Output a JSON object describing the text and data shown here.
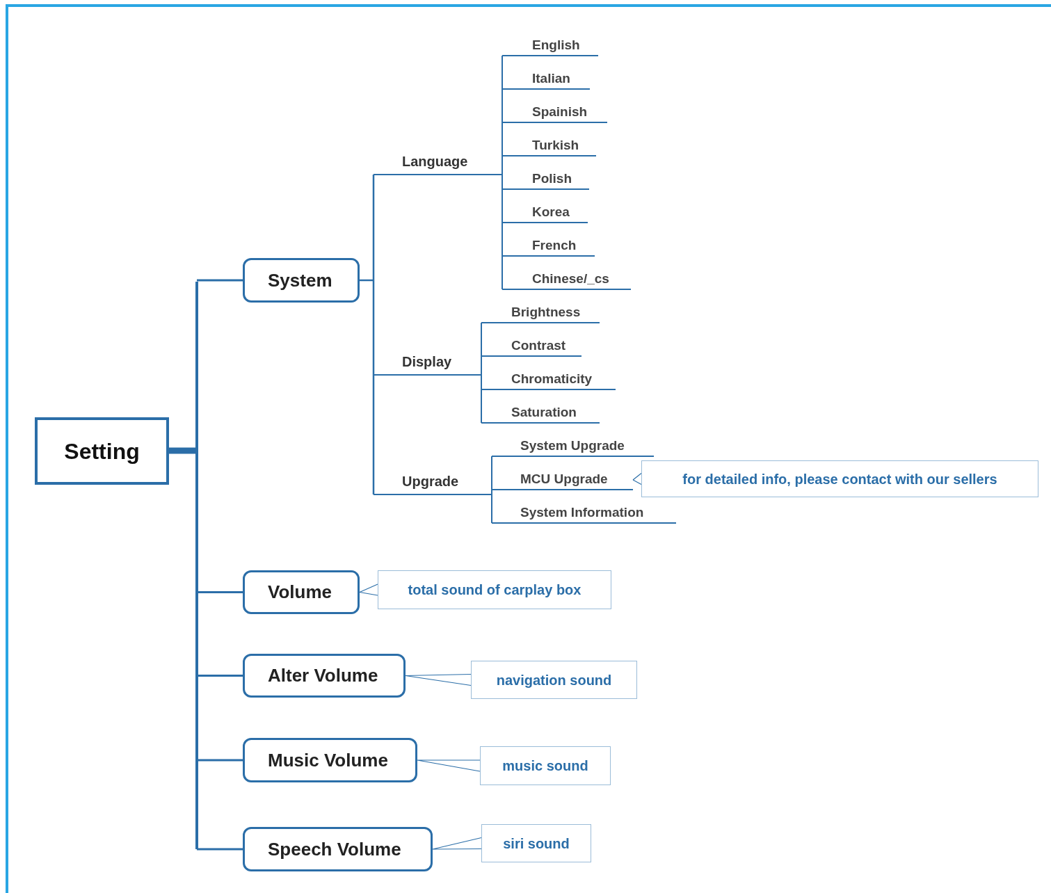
{
  "root": {
    "label": "Setting",
    "children": [
      {
        "label": "System",
        "children": [
          {
            "label": "Language",
            "children": [
              {
                "label": "English"
              },
              {
                "label": "Italian"
              },
              {
                "label": "Spainish"
              },
              {
                "label": "Turkish"
              },
              {
                "label": "Polish"
              },
              {
                "label": "Korea"
              },
              {
                "label": "French"
              },
              {
                "label": "Chinese/_cs"
              }
            ]
          },
          {
            "label": "Display",
            "children": [
              {
                "label": "Brightness"
              },
              {
                "label": "Contrast"
              },
              {
                "label": "Chromaticity"
              },
              {
                "label": "Saturation"
              }
            ]
          },
          {
            "label": "Upgrade",
            "children": [
              {
                "label": "System Upgrade"
              },
              {
                "label": "MCU Upgrade",
                "note": "for detailed info, please contact with our sellers"
              },
              {
                "label": "System Information"
              }
            ]
          }
        ]
      },
      {
        "label": "Volume",
        "note": "total sound of carplay box"
      },
      {
        "label": "Alter Volume",
        "note": "navigation sound"
      },
      {
        "label": "Music Volume",
        "note": "music sound"
      },
      {
        "label": "Speech Volume",
        "note": "siri sound"
      }
    ]
  }
}
